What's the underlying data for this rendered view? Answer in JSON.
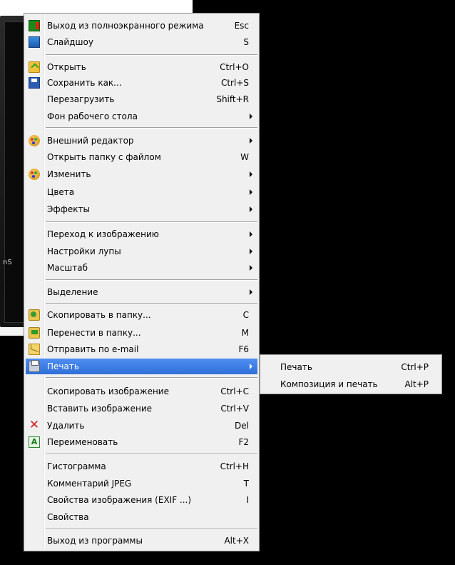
{
  "background": {
    "side_label": "nS"
  },
  "menu": {
    "items": [
      {
        "label": "Выход из полноэкранного режима",
        "shortcut": "Esc",
        "icon": "exit-fullscreen-icon"
      },
      {
        "label": "Слайдшоу",
        "shortcut": "S",
        "icon": "slideshow-icon"
      },
      {
        "label": "Открыть",
        "shortcut": "Ctrl+O",
        "icon": "open-folder-icon"
      },
      {
        "label": "Сохранить как...",
        "shortcut": "Ctrl+S",
        "icon": "save-icon"
      },
      {
        "label": "Перезагрузить",
        "shortcut": "Shift+R"
      },
      {
        "label": "Фон рабочего стола",
        "submenu": true
      },
      {
        "label": "Внешний редактор",
        "submenu": true,
        "icon": "palette-icon"
      },
      {
        "label": "Открыть папку с файлом",
        "shortcut": "W"
      },
      {
        "label": "Изменить",
        "submenu": true,
        "icon": "palette-icon"
      },
      {
        "label": "Цвета",
        "submenu": true
      },
      {
        "label": "Эффекты",
        "submenu": true
      },
      {
        "label": "Переход к изображению",
        "submenu": true
      },
      {
        "label": "Настройки лупы",
        "submenu": true
      },
      {
        "label": "Масштаб",
        "submenu": true
      },
      {
        "label": "Выделение",
        "submenu": true
      },
      {
        "label": "Скопировать в папку...",
        "shortcut": "C",
        "icon": "copy-to-folder-icon"
      },
      {
        "label": "Перенести в папку...",
        "shortcut": "M",
        "icon": "move-to-folder-icon"
      },
      {
        "label": "Отправить по e-mail",
        "shortcut": "F6",
        "icon": "email-icon"
      },
      {
        "label": "Печать",
        "submenu": true,
        "highlighted": true,
        "icon": "printer-icon"
      },
      {
        "label": "Скопировать изображение",
        "shortcut": "Ctrl+C"
      },
      {
        "label": "Вставить изображение",
        "shortcut": "Ctrl+V"
      },
      {
        "label": "Удалить",
        "shortcut": "Del",
        "icon": "delete-icon"
      },
      {
        "label": "Переименовать",
        "shortcut": "F2",
        "icon": "rename-icon"
      },
      {
        "label": "Гистограмма",
        "shortcut": "Ctrl+H"
      },
      {
        "label": "Комментарий JPEG",
        "shortcut": "T"
      },
      {
        "label": "Свойства изображения (EXIF ...)",
        "shortcut": "I"
      },
      {
        "label": "Свойства"
      },
      {
        "label": "Выход из программы",
        "shortcut": "Alt+X"
      }
    ]
  },
  "print_submenu": {
    "items": [
      {
        "label": "Печать",
        "shortcut": "Ctrl+P"
      },
      {
        "label": "Композиция и печать",
        "shortcut": "Alt+P"
      }
    ]
  },
  "colors": {
    "highlight": "#3d7fe6",
    "menu_bg": "#f0f0f0",
    "delete_red": "#d01e1e"
  }
}
